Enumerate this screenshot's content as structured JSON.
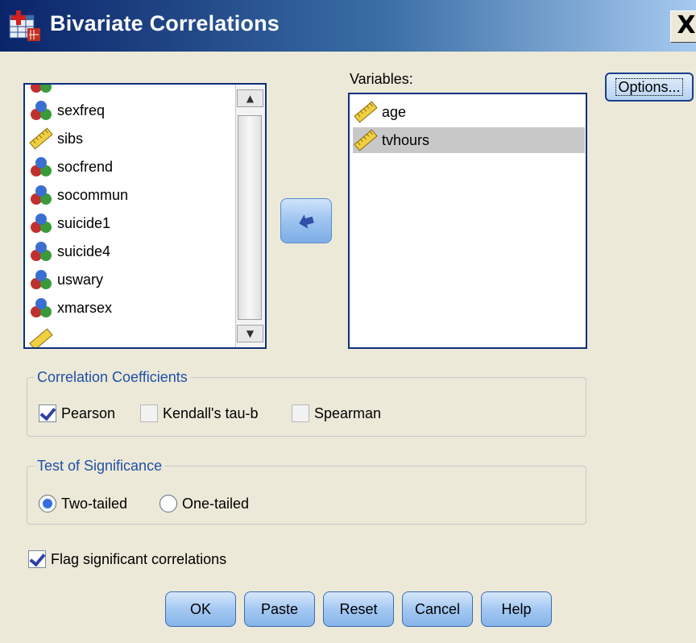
{
  "window": {
    "title": "Bivariate Correlations",
    "close_label": "X"
  },
  "source_list": {
    "items": [
      {
        "label": "sexfreq",
        "icon": "nominal-variable-icon"
      },
      {
        "label": "sibs",
        "icon": "scale-variable-icon"
      },
      {
        "label": "socfrend",
        "icon": "nominal-variable-icon"
      },
      {
        "label": "socommun",
        "icon": "nominal-variable-icon"
      },
      {
        "label": "suicide1",
        "icon": "nominal-variable-icon"
      },
      {
        "label": "suicide4",
        "icon": "nominal-variable-icon"
      },
      {
        "label": "uswary",
        "icon": "nominal-variable-icon"
      },
      {
        "label": "xmarsex",
        "icon": "nominal-variable-icon"
      }
    ]
  },
  "variables": {
    "label": "Variables:",
    "items": [
      {
        "label": "age",
        "icon": "scale-variable-icon",
        "selected": false
      },
      {
        "label": "tvhours",
        "icon": "scale-variable-icon",
        "selected": true
      }
    ]
  },
  "options_button": "Options...",
  "correlation_coefficients": {
    "legend": "Correlation Coefficients",
    "pearson": {
      "label": "Pearson",
      "checked": true
    },
    "kendall": {
      "label": "Kendall's tau-b",
      "checked": false
    },
    "spearman": {
      "label": "Spearman",
      "checked": false
    }
  },
  "test_of_significance": {
    "legend": "Test of Significance",
    "two_tailed": {
      "label": "Two-tailed",
      "selected": true
    },
    "one_tailed": {
      "label": "One-tailed",
      "selected": false
    }
  },
  "flag_significant": {
    "label": "Flag significant correlations",
    "checked": true
  },
  "buttons": {
    "ok": "OK",
    "paste": "Paste",
    "reset": "Reset",
    "cancel": "Cancel",
    "help": "Help"
  },
  "colors": {
    "titlebar_start": "#0A246A",
    "titlebar_end": "#A6CAF0",
    "dialog_bg": "#ECE9D8",
    "group_legend": "#2050A8"
  }
}
